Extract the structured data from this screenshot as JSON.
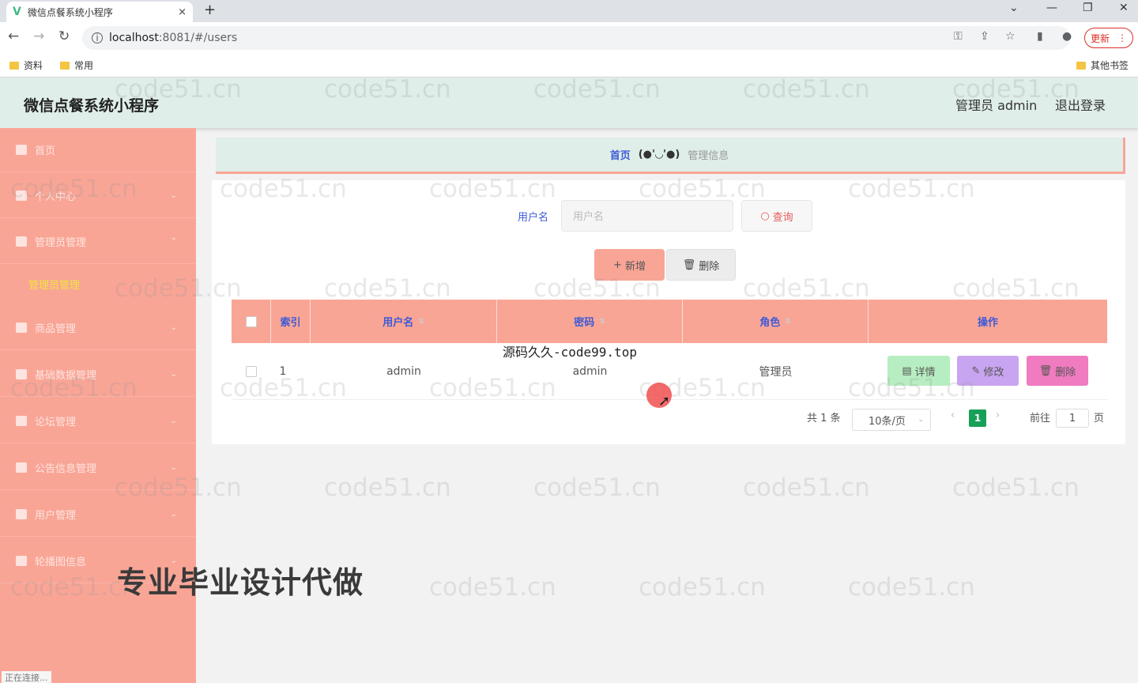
{
  "browser": {
    "tab_title": "微信点餐系统小程序",
    "tab_close": "×",
    "new_tab": "+",
    "url_host": "localhost",
    "url_path": ":8081/#/users",
    "update_label": "更新",
    "update_menu": "⋮",
    "bookmarks": [
      "资料",
      "常用"
    ],
    "other_bookmarks": "其他书签",
    "status_text": "正在连接..."
  },
  "header": {
    "title": "微信点餐系统小程序",
    "user": "管理员 admin",
    "logout": "退出登录"
  },
  "sidebar": {
    "items": [
      {
        "label": "首页",
        "icon": "home-icon"
      },
      {
        "label": "个人中心",
        "icon": "user-icon"
      },
      {
        "label": "管理员管理",
        "icon": "admin-icon"
      },
      {
        "label": "商品管理",
        "icon": "grid-icon"
      },
      {
        "label": "基础数据管理",
        "icon": "table-icon"
      },
      {
        "label": "论坛管理",
        "icon": "forum-icon"
      },
      {
        "label": "公告信息管理",
        "icon": "notice-icon"
      },
      {
        "label": "用户管理",
        "icon": "chart-icon"
      },
      {
        "label": "轮播图信息",
        "icon": "mic-icon"
      }
    ],
    "active_sub": "管理员管理"
  },
  "breadcrumb": {
    "home": "首页",
    "face": "(●'◡'●)",
    "current": "管理信息"
  },
  "search": {
    "label": "用户名",
    "placeholder": "用户名",
    "query_btn": "查询"
  },
  "actions": {
    "add": "新增",
    "delete": "删除"
  },
  "table": {
    "columns": [
      "索引",
      "用户名",
      "密码",
      "角色",
      "操作"
    ],
    "rows": [
      {
        "index": "1",
        "username": "admin",
        "password": "admin",
        "role": "管理员"
      }
    ],
    "ops": {
      "detail": "详情",
      "edit": "修改",
      "delete": "删除"
    }
  },
  "pagination": {
    "total": "共 1 条",
    "page_size": "10条/页",
    "current_page": "1",
    "goto_label": "前往",
    "goto_value": "1",
    "page_suffix": "页"
  },
  "overlays": {
    "watermark": "code51.cn",
    "source_text": "源码久久-code99.top",
    "promo_text": "专业毕业设计代做"
  },
  "colors": {
    "sidebar": "#f9a596",
    "header": "#dfeee8",
    "accent_blue": "#3d5ad6",
    "page_active": "#18a058"
  }
}
